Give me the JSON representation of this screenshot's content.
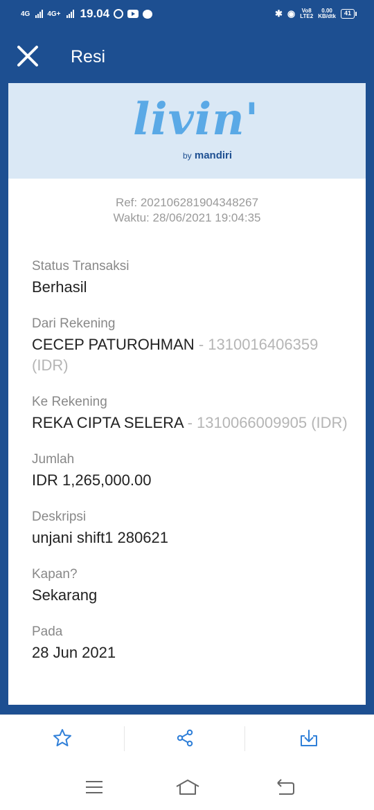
{
  "status_bar": {
    "network1": "4G",
    "network2": "4G+",
    "time": "19.04",
    "volte_top": "Vo8",
    "volte_bottom": "LTE2",
    "speed_value": "0.00",
    "speed_unit": "KB/dtk",
    "battery": "41"
  },
  "appbar": {
    "title": "Resi"
  },
  "logo": {
    "wordmark": "livin'",
    "by": "by",
    "brand": "mandiri"
  },
  "receipt": {
    "ref": "Ref: 202106281904348267",
    "time": "Waktu: 28/06/2021 19:04:35",
    "status": {
      "label": "Status Transaksi",
      "value": "Berhasil"
    },
    "from": {
      "label": "Dari Rekening",
      "name": "CECEP PATUROHMAN",
      "account": " - 1310016406359 (IDR)"
    },
    "to": {
      "label": "Ke Rekening",
      "name": "REKA CIPTA SELERA",
      "account": " - 1310066009905 (IDR)"
    },
    "amount": {
      "label": "Jumlah",
      "value": "IDR 1,265,000.00"
    },
    "description": {
      "label": "Deskripsi",
      "value": "unjani shift1 280621"
    },
    "when": {
      "label": "Kapan?",
      "value": "Sekarang"
    },
    "date": {
      "label": "Pada",
      "value": "28 Jun 2021"
    }
  },
  "bottom_actions": [
    "star-icon",
    "share-icon",
    "download-icon"
  ],
  "colors": {
    "primary": "#1d4f91",
    "header_bg": "#dae8f5",
    "logo": "#5aa9e6",
    "icon": "#2f7fd8"
  }
}
